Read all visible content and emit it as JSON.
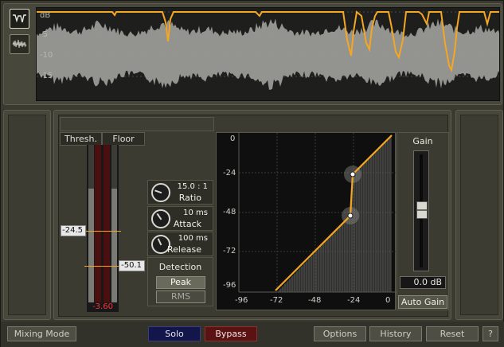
{
  "waveform": {
    "db_labels": [
      "dB",
      "-5",
      "-10",
      "-15"
    ]
  },
  "meters": {
    "threshold_header": "Thresh.",
    "floor_header": "Floor",
    "threshold_value": "-24.5",
    "floor_value": "-50.1",
    "meter_readout": "-3.60"
  },
  "controls": {
    "ratio": {
      "value": "15.0 : 1",
      "label": "Ratio"
    },
    "attack": {
      "value": "10 ms",
      "label": "Attack"
    },
    "release": {
      "value": "100 ms",
      "label": "Release"
    }
  },
  "detection": {
    "title": "Detection",
    "options": [
      "Peak",
      "RMS"
    ],
    "selected": "Peak"
  },
  "graph": {
    "y_labels": [
      "0",
      "-24",
      "-48",
      "-72",
      "-96"
    ],
    "x_labels": [
      "-96",
      "-72",
      "-48",
      "-24",
      "0"
    ]
  },
  "gain": {
    "title": "Gain",
    "value": "0.0",
    "unit": "dB",
    "auto_gain_label": "Auto Gain"
  },
  "bottom_bar": {
    "mixing_mode": "Mixing Mode",
    "solo": "Solo",
    "bypass": "Bypass",
    "options": "Options",
    "history": "History",
    "reset": "Reset",
    "help": "?"
  },
  "colors": {
    "accent": "#f5a623",
    "meter_red": "#8a1a1a",
    "readout_red": "#ff3030"
  }
}
